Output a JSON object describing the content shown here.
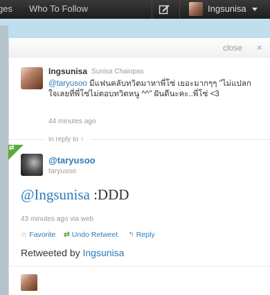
{
  "topbar": {
    "nav_partial": "ges",
    "who_to_follow": "Who To Follow",
    "username": "Ingsunisa"
  },
  "panel": {
    "close_label": "close",
    "close_icon": "×",
    "tweet1": {
      "screen_name": "Ingsunisa",
      "real_name": "Sunisa Chaiopas",
      "mention": "@taryusoo",
      "text": " มีแฟนคลับทวิตมาหาพี่โซ่ เยอะมากๆๆ \"ไม่แปลกใจเลยที่พี่โซ่ไม่ตอบทวิตหนู ^^\" ฝันดีนะคะ..พี่โซ่ <3",
      "time": "44 minutes ago"
    },
    "in_reply_to": "in reply to ↑",
    "tweet2": {
      "screen_name": "@taryusoo",
      "username": "taryusoo",
      "mention": "@Ingsunisa",
      "text": " :DDD",
      "meta": "43 minutes ago via web",
      "actions": {
        "favorite": "Favorite",
        "undo_retweet": "Undo Retweet",
        "reply": "Reply"
      },
      "retweeted_by_label": "Retweeted by ",
      "retweeted_by_user": "Ingsunisa"
    }
  },
  "colors": {
    "link": "#2b7bb9",
    "retweet_green": "#5ea93a",
    "topbar": "#2a2a2a",
    "background": "#c0deed"
  },
  "icons": {
    "compose": "compose-icon",
    "caret": "caret-down-icon",
    "close": "close-icon",
    "star": "star-icon",
    "retweet": "retweet-icon",
    "reply": "reply-icon"
  }
}
